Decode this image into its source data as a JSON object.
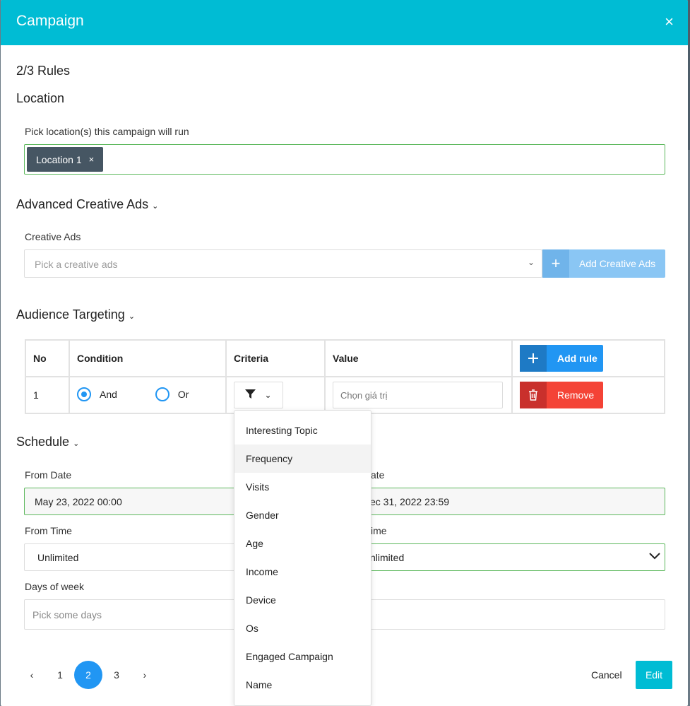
{
  "modal": {
    "title": "Campaign",
    "close": "×"
  },
  "step": "2/3 Rules",
  "location": {
    "heading": "Location",
    "label": "Pick location(s) this campaign will run",
    "tags": [
      {
        "label": "Location 1",
        "remove": "×"
      }
    ]
  },
  "creative": {
    "heading": "Advanced Creative Ads",
    "label": "Creative Ads",
    "placeholder": "Pick a creative ads",
    "add_label": "Add Creative Ads",
    "add_icon": "+"
  },
  "audience": {
    "heading": "Audience Targeting",
    "columns": {
      "no": "No",
      "condition": "Condition",
      "criteria": "Criteria",
      "value": "Value"
    },
    "add_rule_label": "Add rule",
    "rows": [
      {
        "no": "1",
        "and": "And",
        "or": "Or",
        "value_placeholder": "Chọn giá trị",
        "remove_label": "Remove"
      }
    ]
  },
  "criteria_dropdown": {
    "options": [
      "Interesting Topic",
      "Frequency",
      "Visits",
      "Gender",
      "Age",
      "Income",
      "Device",
      "Os",
      "Engaged Campaign",
      "Name"
    ],
    "highlighted": "Frequency"
  },
  "schedule": {
    "heading": "Schedule",
    "from_date_label": "From Date",
    "from_date_value": "May 23, 2022 00:00",
    "to_date_label_visible": "ate",
    "to_date_value_visible": "ec 31, 2022 23:59",
    "from_time_label": "From Time",
    "from_time_value": "Unlimited",
    "to_time_label_visible": "ime",
    "to_time_value_visible": "nlimited",
    "days_label": "Days of week",
    "days_placeholder": "Pick some days"
  },
  "pagination": {
    "prev": "‹",
    "pages": [
      "1",
      "2",
      "3"
    ],
    "current": "2",
    "next": "›"
  },
  "footer": {
    "cancel": "Cancel",
    "edit": "Edit"
  },
  "colors": {
    "header": "#00bcd4",
    "primary": "#2196f3",
    "danger": "#f44336",
    "success_border": "#5cb85c",
    "tag": "#465663"
  }
}
